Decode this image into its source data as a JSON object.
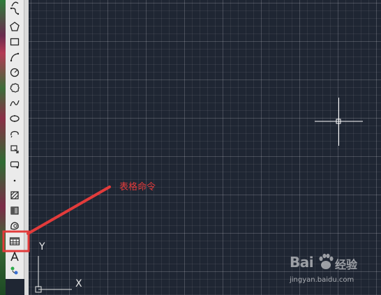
{
  "annotation": {
    "text": "表格命令"
  },
  "ucs": {
    "x_label": "X",
    "y_label": "Y"
  },
  "watermark": {
    "brand": "Bai",
    "brand_suffix": "经验",
    "url": "jingyan.baidu.com"
  },
  "colors": {
    "canvas": "#1f2633",
    "annotation_red": "#e23b3b",
    "toolbar": "#ebebeb"
  },
  "toolbar": {
    "items": [
      {
        "name": "arc-small-icon"
      },
      {
        "name": "polyline-icon"
      },
      {
        "name": "polygon-icon"
      },
      {
        "name": "rectangle-icon"
      },
      {
        "name": "arc-icon"
      },
      {
        "name": "circle-icon"
      },
      {
        "name": "revision-cloud-icon"
      },
      {
        "name": "spline-icon"
      },
      {
        "name": "ellipse-icon"
      },
      {
        "name": "ellipse-arc-icon"
      },
      {
        "name": "insert-block-icon"
      },
      {
        "name": "make-block-icon"
      },
      {
        "name": "point-icon"
      },
      {
        "name": "hatch-icon"
      },
      {
        "name": "gradient-icon"
      },
      {
        "name": "region-icon"
      },
      {
        "name": "table-icon"
      },
      {
        "name": "multiline-text-icon"
      },
      {
        "name": "add-selected-icon"
      }
    ]
  }
}
